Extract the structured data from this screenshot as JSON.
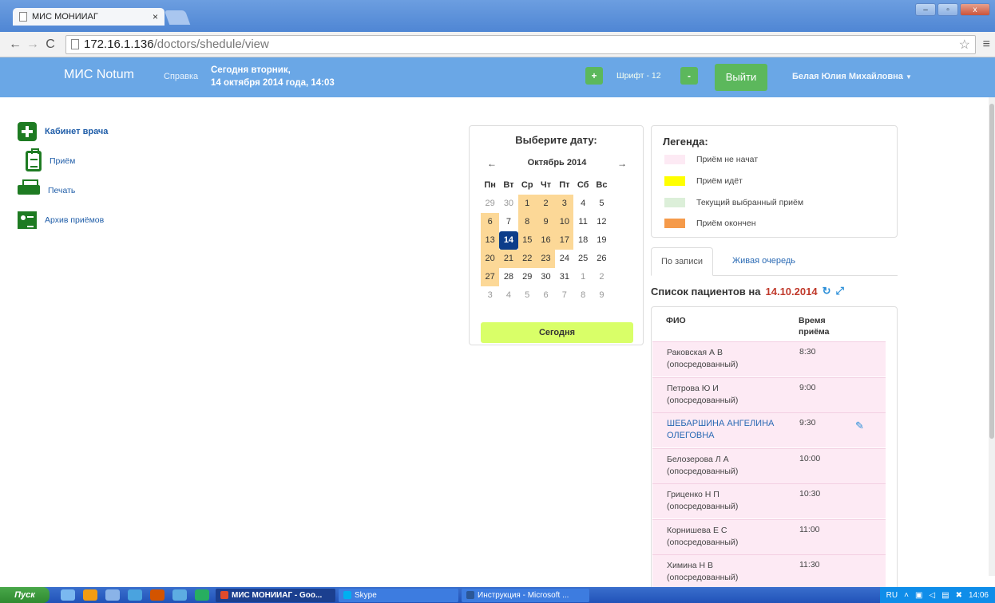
{
  "browser": {
    "tab_title": "МИС МОНИИАГ",
    "url_host": "172.16.1.136",
    "url_path": "/doctors/shedule/view"
  },
  "header": {
    "logo": "МИС Notum",
    "help": "Справка",
    "today_line1": "Сегодня вторник,",
    "today_line2": "14 октября 2014 года, 14:03",
    "font_plus": "+",
    "font_label": "Шрифт - 12",
    "font_minus": "-",
    "logout": "Выйти",
    "user": "Белая Юлия Михайловна"
  },
  "sidebar": {
    "items": [
      {
        "label": "Кабинет врача",
        "icon": "medkit-icon"
      },
      {
        "label": "Приём",
        "icon": "clipboard-icon"
      },
      {
        "label": "Печать",
        "icon": "printer-icon"
      },
      {
        "label": "Архив приёмов",
        "icon": "archive-icon"
      }
    ]
  },
  "calendar": {
    "title": "Выберите дату:",
    "month": "Октябрь 2014",
    "prev": "←",
    "next": "→",
    "weekdays": [
      "Пн",
      "Вт",
      "Ср",
      "Чт",
      "Пт",
      "Сб",
      "Вс"
    ],
    "days": [
      {
        "d": "29",
        "t": "other"
      },
      {
        "d": "30",
        "t": "other"
      },
      {
        "d": "1",
        "t": "has"
      },
      {
        "d": "2",
        "t": "has"
      },
      {
        "d": "3",
        "t": "has"
      },
      {
        "d": "4",
        "t": ""
      },
      {
        "d": "5",
        "t": ""
      },
      {
        "d": "6",
        "t": "has"
      },
      {
        "d": "7",
        "t": ""
      },
      {
        "d": "8",
        "t": "has"
      },
      {
        "d": "9",
        "t": "has"
      },
      {
        "d": "10",
        "t": "has"
      },
      {
        "d": "11",
        "t": ""
      },
      {
        "d": "12",
        "t": ""
      },
      {
        "d": "13",
        "t": "has"
      },
      {
        "d": "14",
        "t": "sel"
      },
      {
        "d": "15",
        "t": "has"
      },
      {
        "d": "16",
        "t": "has"
      },
      {
        "d": "17",
        "t": "has"
      },
      {
        "d": "18",
        "t": ""
      },
      {
        "d": "19",
        "t": ""
      },
      {
        "d": "20",
        "t": "has"
      },
      {
        "d": "21",
        "t": "has"
      },
      {
        "d": "22",
        "t": "has"
      },
      {
        "d": "23",
        "t": "has"
      },
      {
        "d": "24",
        "t": ""
      },
      {
        "d": "25",
        "t": ""
      },
      {
        "d": "26",
        "t": ""
      },
      {
        "d": "27",
        "t": "has"
      },
      {
        "d": "28",
        "t": ""
      },
      {
        "d": "29",
        "t": ""
      },
      {
        "d": "30",
        "t": ""
      },
      {
        "d": "31",
        "t": ""
      },
      {
        "d": "1",
        "t": "other"
      },
      {
        "d": "2",
        "t": "other"
      },
      {
        "d": "3",
        "t": "other"
      },
      {
        "d": "4",
        "t": "other"
      },
      {
        "d": "5",
        "t": "other"
      },
      {
        "d": "6",
        "t": "other"
      },
      {
        "d": "7",
        "t": "other"
      },
      {
        "d": "8",
        "t": "other"
      },
      {
        "d": "9",
        "t": "other"
      }
    ],
    "today_button": "Сегодня"
  },
  "legend": {
    "title": "Легенда:",
    "items": [
      {
        "label": "Приём не начат",
        "color": "#fdeaf4"
      },
      {
        "label": "Приём идёт",
        "color": "#ffff00"
      },
      {
        "label": "Текущий выбранный приём",
        "color": "#dcefd9"
      },
      {
        "label": "Приём окончен",
        "color": "#f59a4a"
      }
    ]
  },
  "tabs": {
    "by_appointment": "По записи",
    "live_queue": "Живая очередь"
  },
  "patients": {
    "title": "Список пациентов на",
    "date": "14.10.2014",
    "col_name": "ФИО",
    "col_time_1": "Время",
    "col_time_2": "приёма",
    "rows": [
      {
        "name1": "Раковская А В",
        "name2": "(опосредованный)",
        "time": "8:30",
        "current": false
      },
      {
        "name1": "Петрова Ю И",
        "name2": "(опосредованный)",
        "time": "9:00",
        "current": false
      },
      {
        "name1": "ШЕБАРШИНА АНГЕЛИНА",
        "name2": "ОЛЕГОВНА",
        "time": "9:30",
        "current": true
      },
      {
        "name1": "Белозерова Л А",
        "name2": "(опосредованный)",
        "time": "10:00",
        "current": false
      },
      {
        "name1": "Гриценко Н П",
        "name2": "(опосредованный)",
        "time": "10:30",
        "current": false
      },
      {
        "name1": "Корнишева Е С",
        "name2": "(опосредованный)",
        "time": "11:00",
        "current": false
      },
      {
        "name1": "Химина Н В",
        "name2": "(опосредованный)",
        "time": "11:30",
        "current": false
      }
    ]
  },
  "taskbar": {
    "start": "Пуск",
    "tasks": [
      {
        "label": "МИС МОНИИАГ - Goo...",
        "icon_color": "#e04b2c",
        "active": true
      },
      {
        "label": "Skype",
        "icon_color": "#00aff0",
        "active": false
      },
      {
        "label": "Инструкция - Microsoft ...",
        "icon_color": "#2b5797",
        "active": false
      }
    ],
    "lang": "RU",
    "clock": "14:06"
  }
}
